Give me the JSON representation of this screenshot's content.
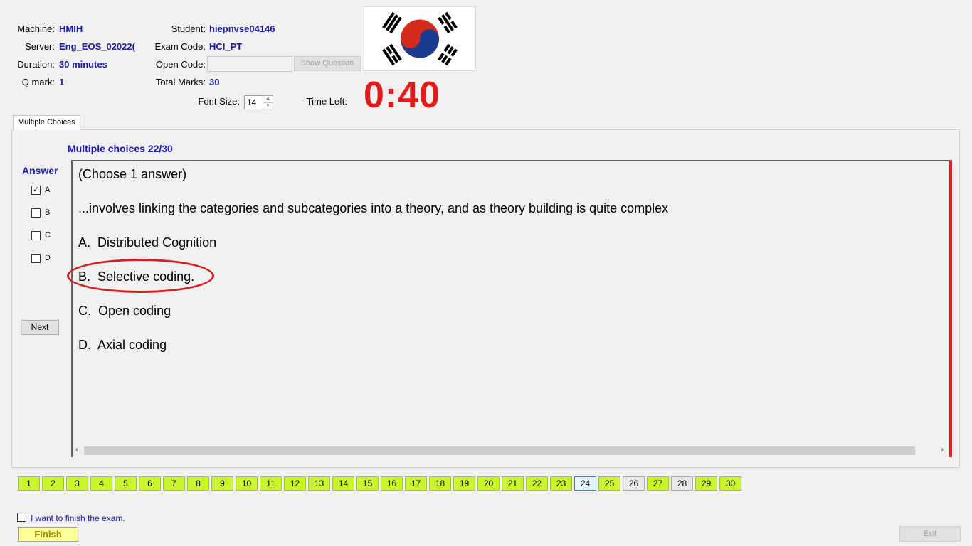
{
  "header": {
    "machine_label": "Machine:",
    "machine_value": "HMIH",
    "server_label": "Server:",
    "server_value": "Eng_EOS_02022(",
    "duration_label": "Duration:",
    "duration_value": "30 minutes",
    "qmark_label": "Q mark:",
    "qmark_value": "1",
    "student_label": "Student:",
    "student_value": "hiepnvse04146",
    "exam_code_label": "Exam Code:",
    "exam_code_value": "HCI_PT",
    "open_code_label": "Open Code:",
    "open_code_value": "",
    "show_question_label": "Show Question",
    "total_marks_label": "Total Marks:",
    "total_marks_value": "30",
    "font_size_label": "Font Size:",
    "font_size_value": "14",
    "time_left_label": "Time Left:",
    "time_left_value": "0:40",
    "flag_icon": "south-korea-flag",
    "timer_color": "#e41b1b"
  },
  "tab": {
    "label": "Multiple Choices"
  },
  "question": {
    "heading": "Multiple choices 22/30",
    "instruction": "(Choose 1 answer)",
    "stem": "...involves linking the categories and subcategories into a theory, and as theory building is quite complex",
    "options": [
      {
        "label": "A.",
        "text": "Distributed Cognition"
      },
      {
        "label": "B.",
        "text": "Selective coding."
      },
      {
        "label": "C.",
        "text": "Open coding"
      },
      {
        "label": "D.",
        "text": "Axial coding"
      }
    ],
    "highlight_color": "#d62020"
  },
  "answer_panel": {
    "title": "Answer",
    "choices": [
      {
        "label": "A",
        "checked": true
      },
      {
        "label": "B",
        "checked": false
      },
      {
        "label": "C",
        "checked": false
      },
      {
        "label": "D",
        "checked": false
      }
    ],
    "next_label": "Next"
  },
  "navigation": {
    "questions": [
      "1",
      "2",
      "3",
      "4",
      "5",
      "6",
      "7",
      "8",
      "9",
      "10",
      "11",
      "12",
      "13",
      "14",
      "15",
      "16",
      "17",
      "18",
      "19",
      "20",
      "21",
      "22",
      "23",
      "24",
      "25",
      "26",
      "27",
      "28",
      "29",
      "30"
    ],
    "current": "24",
    "unanswered": [
      "26",
      "28"
    ],
    "answered_color": "#c8f52c"
  },
  "footer": {
    "finish_checkbox_label": "I want to finish the exam.",
    "finish_label": "Finish",
    "exit_label": "Exit"
  }
}
